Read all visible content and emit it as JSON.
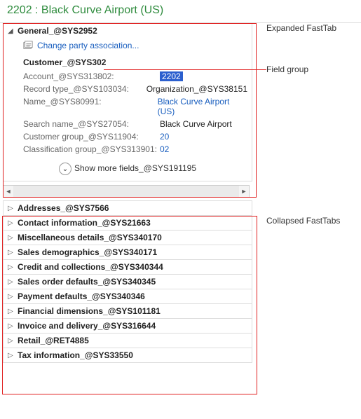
{
  "header": {
    "title": "2202 : Black Curve Airport (US)"
  },
  "expanded_tab": {
    "title": "General_@SYS2952",
    "action": "Change party association...",
    "group_title": "Customer_@SYS302",
    "fields": [
      {
        "label": "Account_@SYS313802:",
        "value": "2202",
        "style": "sel"
      },
      {
        "label": "Record type_@SYS103034:",
        "value": " Organization_@SYS38151",
        "style": "plain"
      },
      {
        "label": "Name_@SYS80991:",
        "value": "Black Curve Airport (US)",
        "style": "link"
      },
      {
        "label": "Search name_@SYS27054:",
        "value": "Black Curve Airport",
        "style": "plain"
      },
      {
        "label": "Customer group_@SYS11904:",
        "value": "20",
        "style": "link"
      },
      {
        "label": "Classification group_@SYS313901:",
        "value": "02",
        "style": "link"
      }
    ],
    "show_more": "Show more fields_@SYS191195"
  },
  "collapsed_tabs": [
    "Addresses_@SYS7566",
    "Contact information_@SYS21663",
    "Miscellaneous details_@SYS340170",
    "Sales demographics_@SYS340171",
    "Credit and collections_@SYS340344",
    "Sales order defaults_@SYS340345",
    "Payment defaults_@SYS340346",
    "Financial dimensions_@SYS101181",
    "Invoice and delivery_@SYS316644",
    "Retail_@RET4885",
    "Tax information_@SYS33550"
  ],
  "annotations": {
    "expanded": "Expanded FastTab",
    "field_group": "Field group",
    "collapsed": "Collapsed FastTabs"
  }
}
